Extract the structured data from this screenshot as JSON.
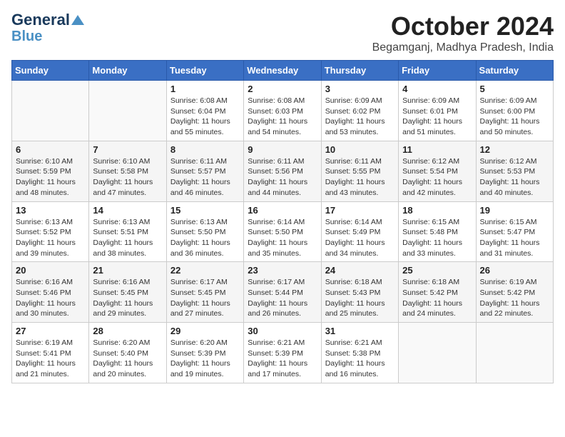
{
  "header": {
    "logo_line1": "General",
    "logo_line2": "Blue",
    "title": "October 2024",
    "subtitle": "Begamganj, Madhya Pradesh, India"
  },
  "days_of_week": [
    "Sunday",
    "Monday",
    "Tuesday",
    "Wednesday",
    "Thursday",
    "Friday",
    "Saturday"
  ],
  "weeks": [
    [
      {
        "num": "",
        "info": ""
      },
      {
        "num": "",
        "info": ""
      },
      {
        "num": "1",
        "info": "Sunrise: 6:08 AM\nSunset: 6:04 PM\nDaylight: 11 hours and 55 minutes."
      },
      {
        "num": "2",
        "info": "Sunrise: 6:08 AM\nSunset: 6:03 PM\nDaylight: 11 hours and 54 minutes."
      },
      {
        "num": "3",
        "info": "Sunrise: 6:09 AM\nSunset: 6:02 PM\nDaylight: 11 hours and 53 minutes."
      },
      {
        "num": "4",
        "info": "Sunrise: 6:09 AM\nSunset: 6:01 PM\nDaylight: 11 hours and 51 minutes."
      },
      {
        "num": "5",
        "info": "Sunrise: 6:09 AM\nSunset: 6:00 PM\nDaylight: 11 hours and 50 minutes."
      }
    ],
    [
      {
        "num": "6",
        "info": "Sunrise: 6:10 AM\nSunset: 5:59 PM\nDaylight: 11 hours and 48 minutes."
      },
      {
        "num": "7",
        "info": "Sunrise: 6:10 AM\nSunset: 5:58 PM\nDaylight: 11 hours and 47 minutes."
      },
      {
        "num": "8",
        "info": "Sunrise: 6:11 AM\nSunset: 5:57 PM\nDaylight: 11 hours and 46 minutes."
      },
      {
        "num": "9",
        "info": "Sunrise: 6:11 AM\nSunset: 5:56 PM\nDaylight: 11 hours and 44 minutes."
      },
      {
        "num": "10",
        "info": "Sunrise: 6:11 AM\nSunset: 5:55 PM\nDaylight: 11 hours and 43 minutes."
      },
      {
        "num": "11",
        "info": "Sunrise: 6:12 AM\nSunset: 5:54 PM\nDaylight: 11 hours and 42 minutes."
      },
      {
        "num": "12",
        "info": "Sunrise: 6:12 AM\nSunset: 5:53 PM\nDaylight: 11 hours and 40 minutes."
      }
    ],
    [
      {
        "num": "13",
        "info": "Sunrise: 6:13 AM\nSunset: 5:52 PM\nDaylight: 11 hours and 39 minutes."
      },
      {
        "num": "14",
        "info": "Sunrise: 6:13 AM\nSunset: 5:51 PM\nDaylight: 11 hours and 38 minutes."
      },
      {
        "num": "15",
        "info": "Sunrise: 6:13 AM\nSunset: 5:50 PM\nDaylight: 11 hours and 36 minutes."
      },
      {
        "num": "16",
        "info": "Sunrise: 6:14 AM\nSunset: 5:50 PM\nDaylight: 11 hours and 35 minutes."
      },
      {
        "num": "17",
        "info": "Sunrise: 6:14 AM\nSunset: 5:49 PM\nDaylight: 11 hours and 34 minutes."
      },
      {
        "num": "18",
        "info": "Sunrise: 6:15 AM\nSunset: 5:48 PM\nDaylight: 11 hours and 33 minutes."
      },
      {
        "num": "19",
        "info": "Sunrise: 6:15 AM\nSunset: 5:47 PM\nDaylight: 11 hours and 31 minutes."
      }
    ],
    [
      {
        "num": "20",
        "info": "Sunrise: 6:16 AM\nSunset: 5:46 PM\nDaylight: 11 hours and 30 minutes."
      },
      {
        "num": "21",
        "info": "Sunrise: 6:16 AM\nSunset: 5:45 PM\nDaylight: 11 hours and 29 minutes."
      },
      {
        "num": "22",
        "info": "Sunrise: 6:17 AM\nSunset: 5:45 PM\nDaylight: 11 hours and 27 minutes."
      },
      {
        "num": "23",
        "info": "Sunrise: 6:17 AM\nSunset: 5:44 PM\nDaylight: 11 hours and 26 minutes."
      },
      {
        "num": "24",
        "info": "Sunrise: 6:18 AM\nSunset: 5:43 PM\nDaylight: 11 hours and 25 minutes."
      },
      {
        "num": "25",
        "info": "Sunrise: 6:18 AM\nSunset: 5:42 PM\nDaylight: 11 hours and 24 minutes."
      },
      {
        "num": "26",
        "info": "Sunrise: 6:19 AM\nSunset: 5:42 PM\nDaylight: 11 hours and 22 minutes."
      }
    ],
    [
      {
        "num": "27",
        "info": "Sunrise: 6:19 AM\nSunset: 5:41 PM\nDaylight: 11 hours and 21 minutes."
      },
      {
        "num": "28",
        "info": "Sunrise: 6:20 AM\nSunset: 5:40 PM\nDaylight: 11 hours and 20 minutes."
      },
      {
        "num": "29",
        "info": "Sunrise: 6:20 AM\nSunset: 5:39 PM\nDaylight: 11 hours and 19 minutes."
      },
      {
        "num": "30",
        "info": "Sunrise: 6:21 AM\nSunset: 5:39 PM\nDaylight: 11 hours and 17 minutes."
      },
      {
        "num": "31",
        "info": "Sunrise: 6:21 AM\nSunset: 5:38 PM\nDaylight: 11 hours and 16 minutes."
      },
      {
        "num": "",
        "info": ""
      },
      {
        "num": "",
        "info": ""
      }
    ]
  ]
}
